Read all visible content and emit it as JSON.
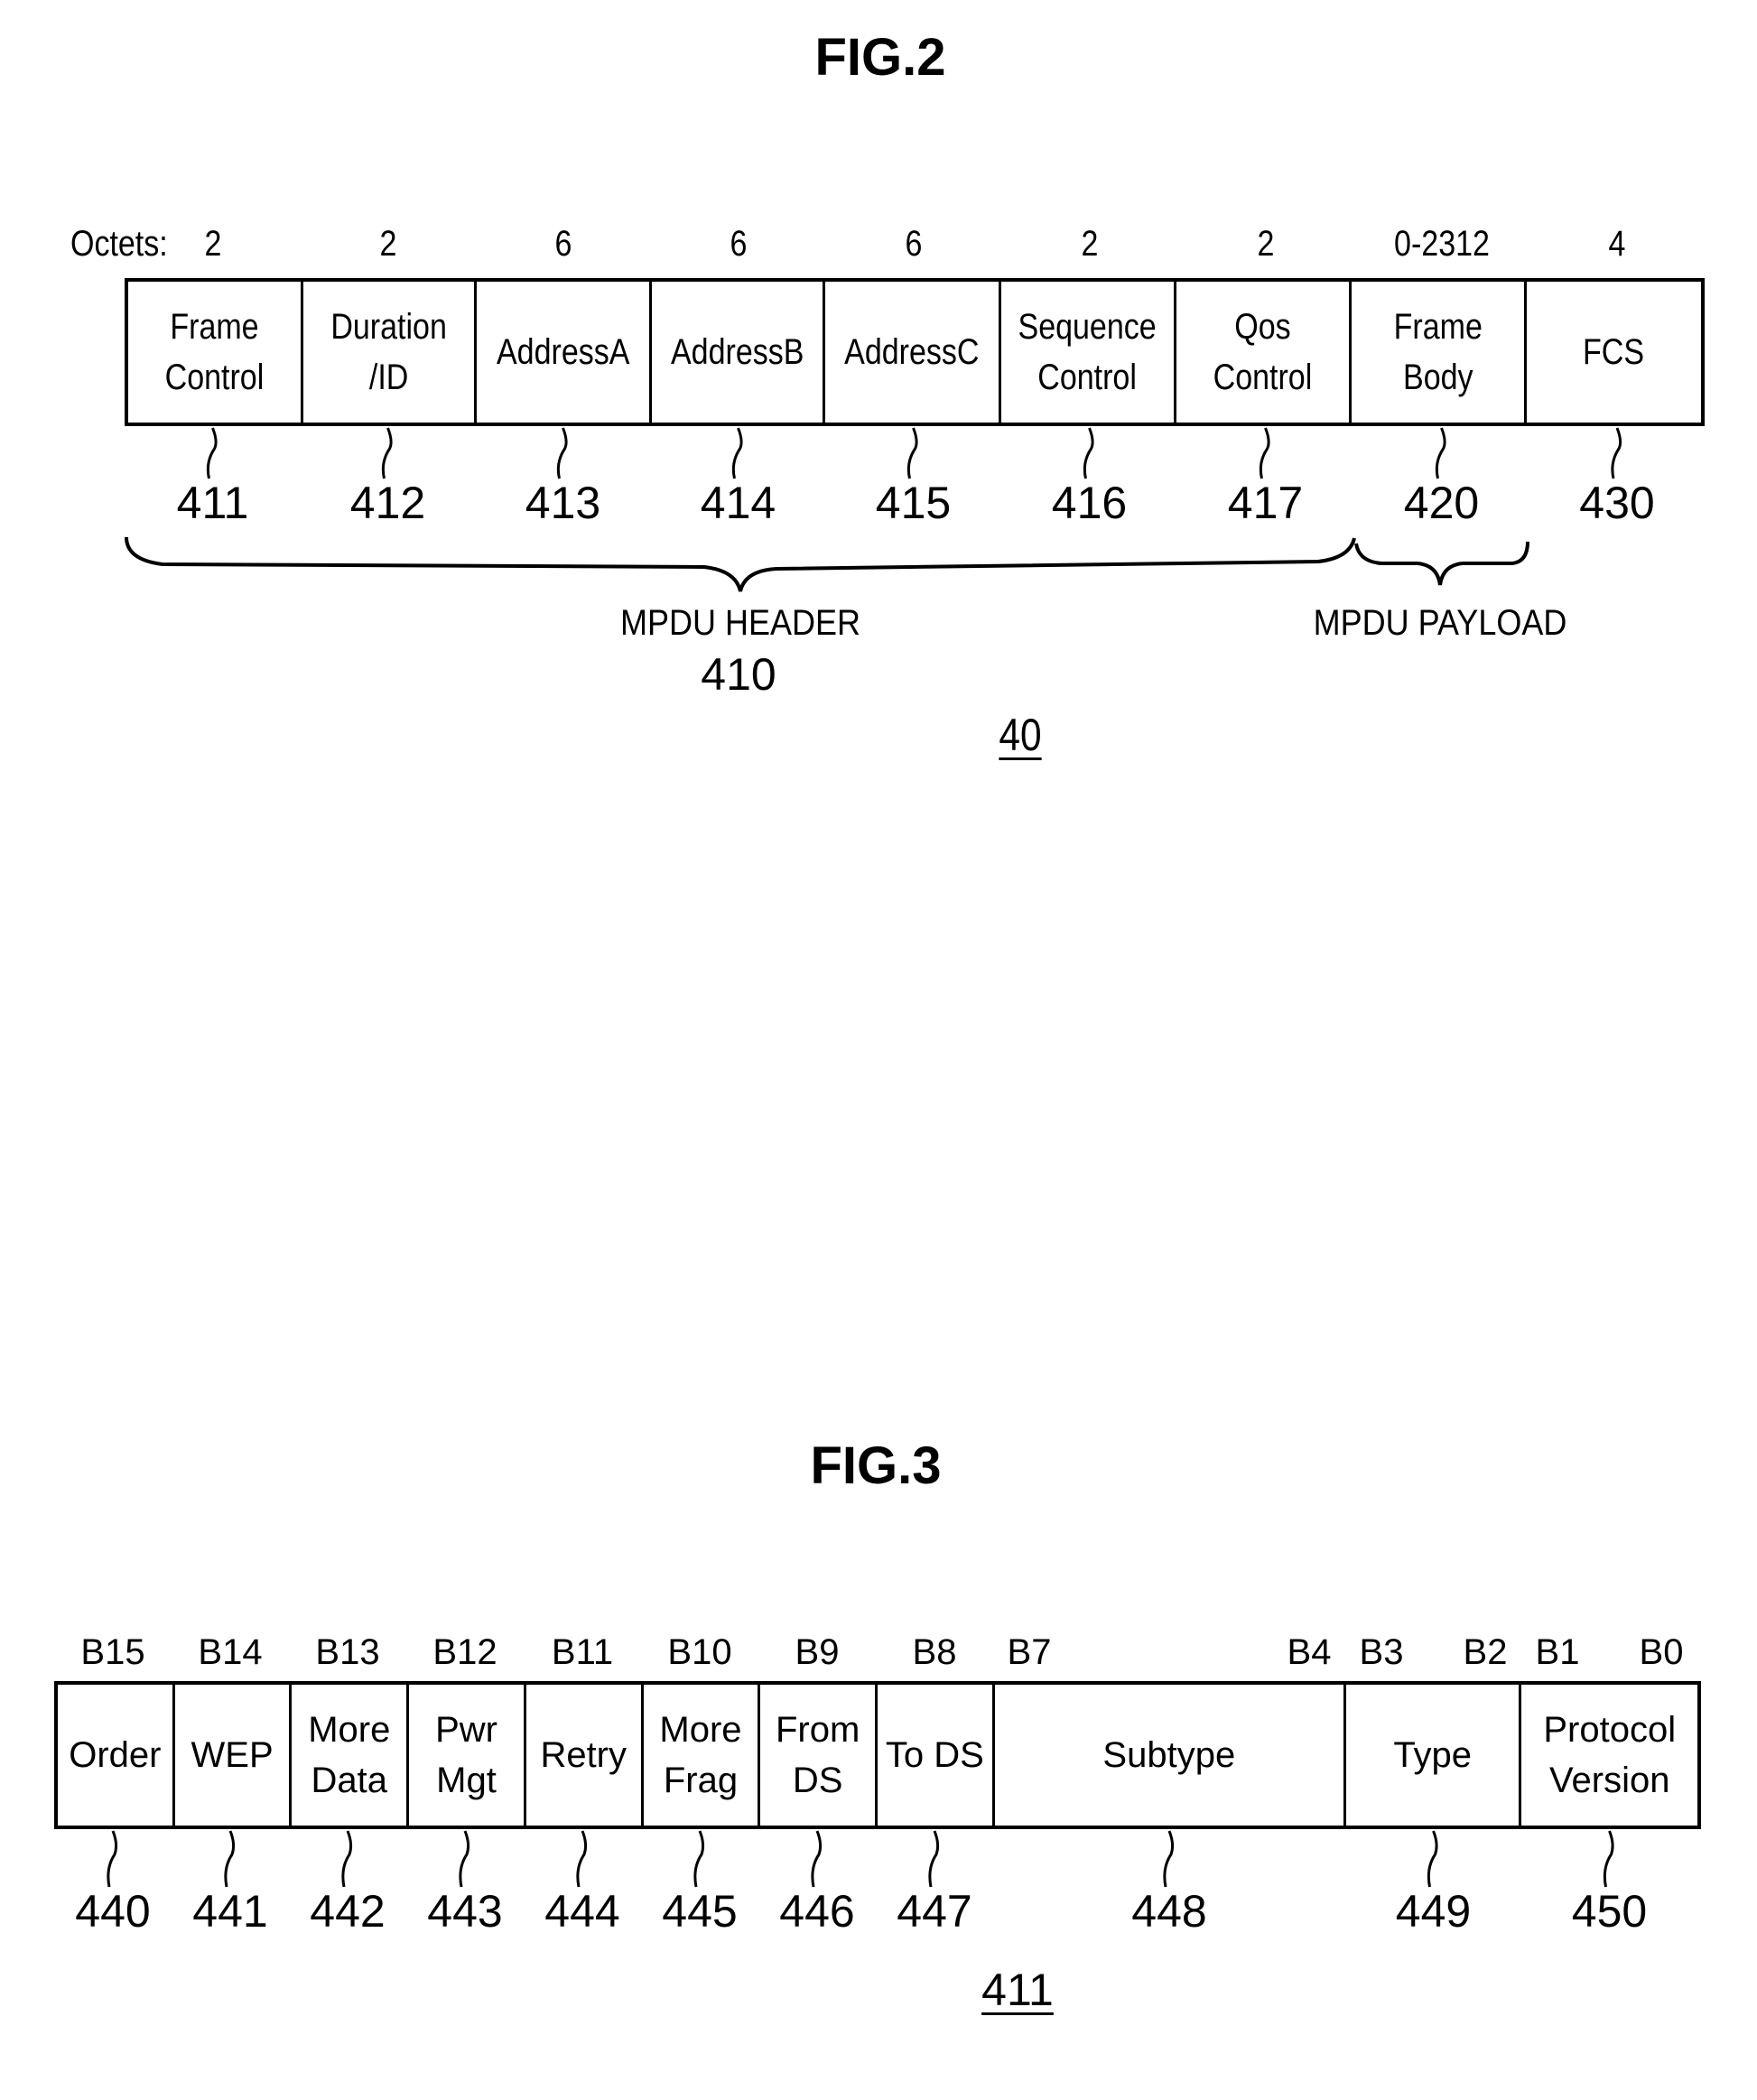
{
  "fig2": {
    "title": "FIG.2",
    "octets_label": "Octets:",
    "fields": [
      {
        "label": "Frame\nControl",
        "octets": "2",
        "ref": "411"
      },
      {
        "label": "Duration\n/ID",
        "octets": "2",
        "ref": "412"
      },
      {
        "label": "AddressA",
        "octets": "6",
        "ref": "413"
      },
      {
        "label": "AddressB",
        "octets": "6",
        "ref": "414"
      },
      {
        "label": "AddressC",
        "octets": "6",
        "ref": "415"
      },
      {
        "label": "Sequence\nControl",
        "octets": "2",
        "ref": "416"
      },
      {
        "label": "Qos\nControl",
        "octets": "2",
        "ref": "417"
      },
      {
        "label": "Frame\nBody",
        "octets": "0-2312",
        "ref": "420"
      },
      {
        "label": "FCS",
        "octets": "4",
        "ref": "430"
      }
    ],
    "header_brace": {
      "label": "MPDU HEADER",
      "ref": "410"
    },
    "payload_brace": {
      "label": "MPDU PAYLOAD"
    },
    "figure_ref": "40"
  },
  "fig3": {
    "title": "FIG.3",
    "fields": [
      {
        "label": "Order",
        "bits": [
          "B15"
        ],
        "ref": "440"
      },
      {
        "label": "WEP",
        "bits": [
          "B14"
        ],
        "ref": "441"
      },
      {
        "label": "More\nData",
        "bits": [
          "B13"
        ],
        "ref": "442"
      },
      {
        "label": "Pwr\nMgt",
        "bits": [
          "B12"
        ],
        "ref": "443"
      },
      {
        "label": "Retry",
        "bits": [
          "B11"
        ],
        "ref": "444"
      },
      {
        "label": "More\nFrag",
        "bits": [
          "B10"
        ],
        "ref": "445"
      },
      {
        "label": "From\nDS",
        "bits": [
          "B9"
        ],
        "ref": "446"
      },
      {
        "label": "To DS",
        "bits": [
          "B8"
        ],
        "ref": "447"
      },
      {
        "label": "Subtype",
        "bits": [
          "B7",
          "B4"
        ],
        "ref": "448"
      },
      {
        "label": "Type",
        "bits": [
          "B3",
          "B2"
        ],
        "ref": "449"
      },
      {
        "label": "Protocol\nVersion",
        "bits": [
          "B1",
          "B0"
        ],
        "ref": "450"
      }
    ],
    "figure_ref": "411"
  }
}
